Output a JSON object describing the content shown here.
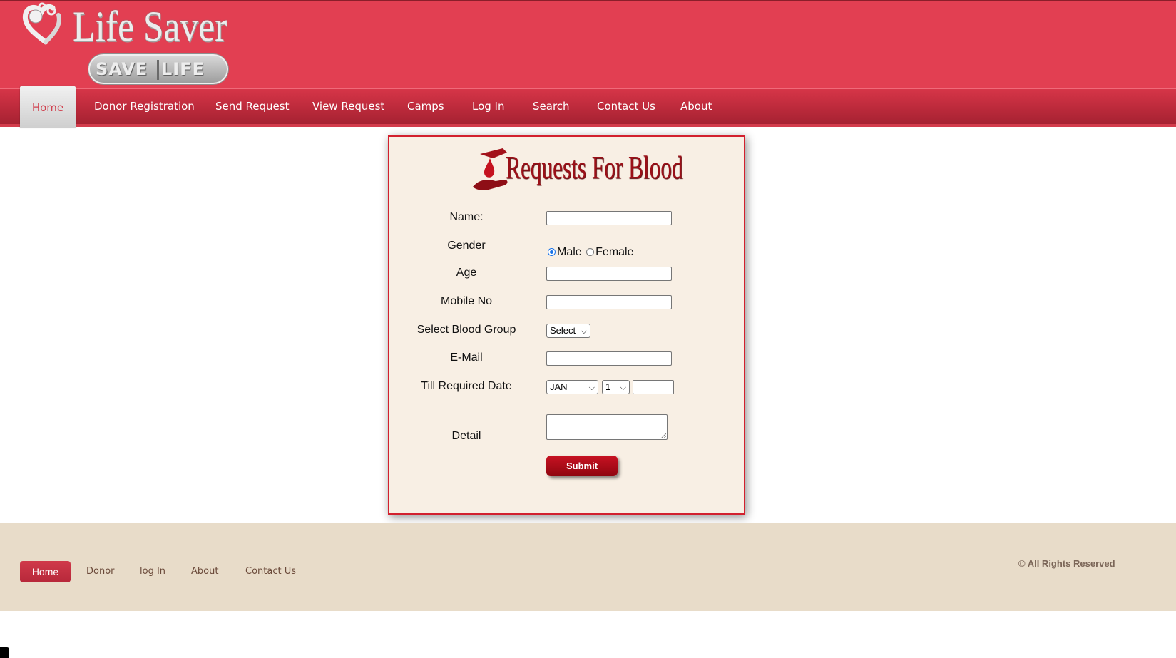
{
  "brand": {
    "name": "Life Saver",
    "badge_left": "SAVE",
    "badge_right": "LIFE"
  },
  "nav": {
    "items": [
      {
        "label": "Home",
        "active": true
      },
      {
        "label": "Donor Registration"
      },
      {
        "label": "Send Request"
      },
      {
        "label": "View Request"
      },
      {
        "label": "Camps"
      },
      {
        "label": "Log In"
      },
      {
        "label": "Search"
      },
      {
        "label": "Contact Us"
      },
      {
        "label": "About"
      }
    ]
  },
  "form": {
    "heading": "Requests For Blood",
    "labels": {
      "name": "Name:",
      "gender": "Gender",
      "age": "Age",
      "mobile": "Mobile No",
      "blood_group": "Select Blood Group",
      "email": "E-Mail",
      "date": "Till Required Date",
      "detail": "Detail"
    },
    "values": {
      "name": "",
      "age": "",
      "mobile": "",
      "email": "",
      "year": "",
      "detail": ""
    },
    "gender_options": [
      {
        "label": "Male",
        "checked": true
      },
      {
        "label": "Female",
        "checked": false
      }
    ],
    "blood_group_selected": "Select",
    "month_selected": "JAN",
    "day_selected": "1",
    "submit_label": "Submit"
  },
  "footer": {
    "links": [
      {
        "label": "Home",
        "active": true
      },
      {
        "label": "Donor"
      },
      {
        "label": "log In"
      },
      {
        "label": "About"
      },
      {
        "label": "Contact Us"
      }
    ],
    "copyright": "© All Rights Reserved"
  },
  "colors": {
    "header_bg": "#e23f52",
    "nav_bg": "#b9293a",
    "card_bg": "#f8efe4",
    "card_border": "#d2202e",
    "heading_red": "#9b1018",
    "footer_bg": "#e8dcc9"
  }
}
